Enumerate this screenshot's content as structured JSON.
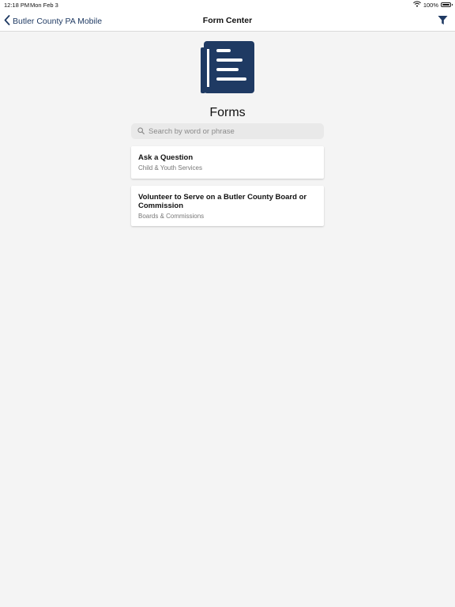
{
  "status_bar": {
    "time": "12:18 PM",
    "date": "Mon Feb 3",
    "battery_text": "100%",
    "battery_level": 1.0
  },
  "nav": {
    "back_label": "Butler County PA Mobile",
    "title": "Form Center",
    "back_icon": "chevron-left-icon",
    "filter_icon": "filter-icon"
  },
  "page": {
    "icon": "forms-document-icon",
    "heading": "Forms"
  },
  "search": {
    "placeholder": "Search by word or phrase",
    "value": ""
  },
  "forms": [
    {
      "title": "Ask a Question",
      "category": "Child & Youth Services"
    },
    {
      "title": "Volunteer to Serve on a Butler County Board or Commission",
      "category": "Boards & Commissions"
    }
  ],
  "colors": {
    "accent": "#1f3a63",
    "background": "#f4f4f4",
    "card": "#ffffff"
  }
}
